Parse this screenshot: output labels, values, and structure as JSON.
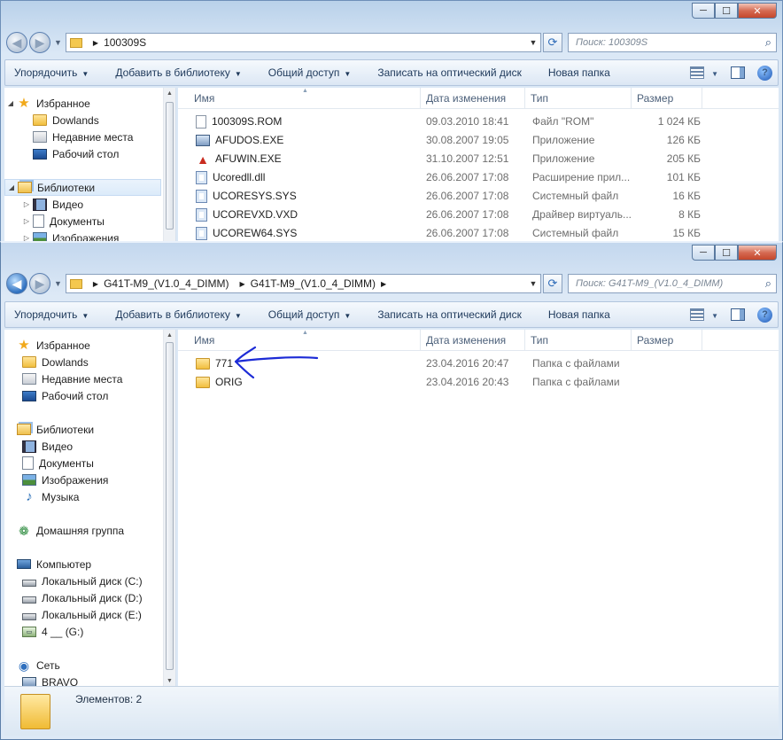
{
  "back_window": {
    "address_crumbs": [
      "100309S"
    ],
    "search_placeholder": "Поиск: 100309S",
    "toolbar": [
      "Упорядочить",
      "Добавить в библиотеку",
      "Общий доступ",
      "Записать на оптический диск",
      "Новая папка"
    ],
    "toolbar_dropdowns": [
      true,
      true,
      true,
      false,
      false
    ],
    "nav": [
      {
        "label": "Избранное",
        "icon": "star-icon",
        "level": 0,
        "expander": "◢"
      },
      {
        "label": "Dowlands",
        "icon": "folder-icon",
        "level": 1
      },
      {
        "label": "Недавние места",
        "icon": "recent-places-icon",
        "level": 1
      },
      {
        "label": "Рабочий стол",
        "icon": "desktop-icon",
        "level": 1
      },
      {
        "label": "Библиотеки",
        "icon": "libraries-icon",
        "level": 0,
        "expander": "◢",
        "selected": true
      },
      {
        "label": "Видео",
        "icon": "video-library-icon",
        "level": 1,
        "expander": "▷"
      },
      {
        "label": "Документы",
        "icon": "documents-library-icon",
        "level": 1,
        "expander": "▷"
      },
      {
        "label": "Изображения",
        "icon": "pictures-library-icon",
        "level": 1,
        "expander": "▷"
      }
    ],
    "columns": {
      "name": "Имя",
      "date": "Дата изменения",
      "type": "Тип",
      "size": "Размер"
    },
    "files": [
      {
        "name": "100309S.ROM",
        "date": "09.03.2010 18:41",
        "type": "Файл \"ROM\"",
        "size": "1 024 КБ",
        "icon": "rom-file-icon"
      },
      {
        "name": "AFUDOS.EXE",
        "date": "30.08.2007 19:05",
        "type": "Приложение",
        "size": "126 КБ",
        "icon": "exe-file-icon"
      },
      {
        "name": "AFUWIN.EXE",
        "date": "31.10.2007 12:51",
        "type": "Приложение",
        "size": "205 КБ",
        "icon": "afuwin-app-icon"
      },
      {
        "name": "Ucoredll.dll",
        "date": "26.06.2007 17:08",
        "type": "Расширение прил...",
        "size": "101 КБ",
        "icon": "dll-file-icon"
      },
      {
        "name": "UCORESYS.SYS",
        "date": "26.06.2007 17:08",
        "type": "Системный файл",
        "size": "16 КБ",
        "icon": "sys-file-icon"
      },
      {
        "name": "UCOREVXD.VXD",
        "date": "26.06.2007 17:08",
        "type": "Драйвер виртуаль...",
        "size": "8 КБ",
        "icon": "vxd-file-icon"
      },
      {
        "name": "UCOREW64.SYS",
        "date": "26.06.2007 17:08",
        "type": "Системный файл",
        "size": "15 КБ",
        "icon": "sys-file-icon"
      }
    ]
  },
  "front_window": {
    "address_crumbs": [
      "G41T-M9_(V1.0_4_DIMM)",
      "G41T-M9_(V1.0_4_DIMM)"
    ],
    "search_placeholder": "Поиск: G41T-M9_(V1.0_4_DIMM)",
    "toolbar": [
      "Упорядочить",
      "Добавить в библиотеку",
      "Общий доступ",
      "Записать на оптический диск",
      "Новая папка"
    ],
    "toolbar_dropdowns": [
      true,
      true,
      true,
      false,
      false
    ],
    "nav": [
      {
        "label": "Избранное",
        "icon": "star-icon",
        "level": 0
      },
      {
        "label": "Dowlands",
        "icon": "folder-icon",
        "level": 1
      },
      {
        "label": "Недавние места",
        "icon": "recent-places-icon",
        "level": 1
      },
      {
        "label": "Рабочий стол",
        "icon": "desktop-icon",
        "level": 1
      },
      {
        "label": "Библиотеки",
        "icon": "libraries-icon",
        "level": 0
      },
      {
        "label": "Видео",
        "icon": "video-library-icon",
        "level": 1
      },
      {
        "label": "Документы",
        "icon": "documents-library-icon",
        "level": 1
      },
      {
        "label": "Изображения",
        "icon": "pictures-library-icon",
        "level": 1
      },
      {
        "label": "Музыка",
        "icon": "music-library-icon",
        "level": 1
      },
      {
        "label": "Домашняя группа",
        "icon": "homegroup-icon",
        "level": 0
      },
      {
        "label": "Компьютер",
        "icon": "computer-icon",
        "level": 0
      },
      {
        "label": "Локальный диск (C:)",
        "icon": "local-disk-c-icon",
        "level": 1
      },
      {
        "label": "Локальный диск (D:)",
        "icon": "local-disk-icon",
        "level": 1
      },
      {
        "label": "Локальный диск (E:)",
        "icon": "local-disk-icon",
        "level": 1
      },
      {
        "label": "4 __ (G:)",
        "icon": "removable-drive-icon",
        "level": 1
      },
      {
        "label": "Сеть",
        "icon": "network-icon",
        "level": 0
      },
      {
        "label": "BRAVO",
        "icon": "network-computer-icon",
        "level": 1
      }
    ],
    "columns": {
      "name": "Имя",
      "date": "Дата изменения",
      "type": "Тип",
      "size": "Размер"
    },
    "files": [
      {
        "name": "771",
        "date": "23.04.2016 20:47",
        "type": "Папка с файлами",
        "size": "",
        "icon": "folder-icon"
      },
      {
        "name": "ORIG",
        "date": "23.04.2016 20:43",
        "type": "Папка с файлами",
        "size": "",
        "icon": "folder-icon"
      }
    ],
    "status": "Элементов: 2"
  },
  "caption_buttons": {
    "minimize": "─",
    "maximize": "☐",
    "close": "✕"
  },
  "annotation_color": "#1c2bd6"
}
